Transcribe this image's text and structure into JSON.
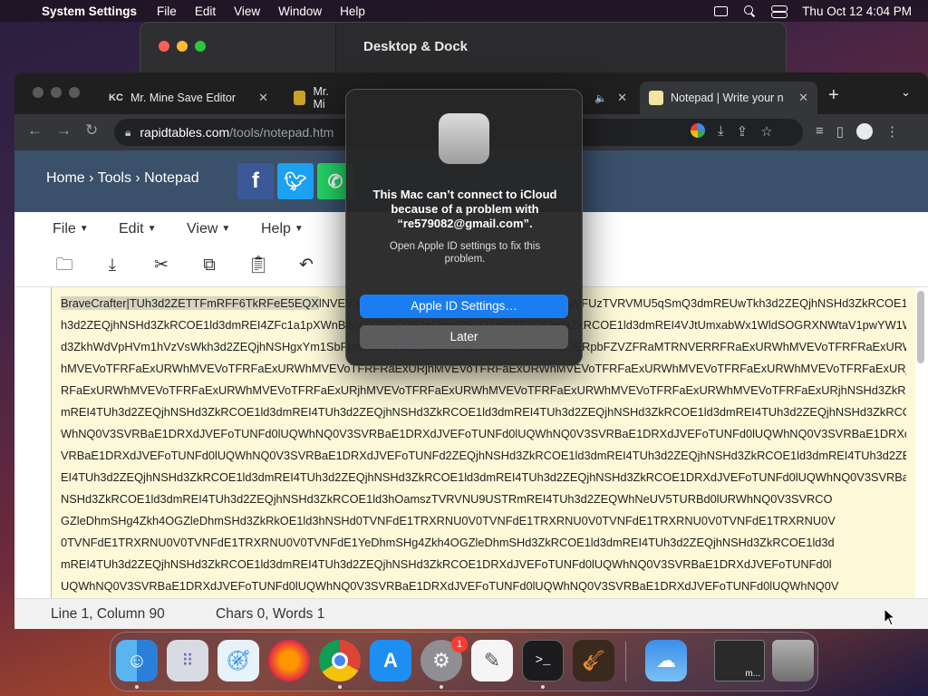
{
  "menubar": {
    "app_name": "System Settings",
    "items": [
      "File",
      "Edit",
      "View",
      "Window",
      "Help"
    ],
    "clock": "Thu Oct 12  4:04 PM"
  },
  "settings_window": {
    "title": "Desktop & Dock"
  },
  "browser": {
    "tabs": [
      {
        "label": "Mr. Mine Save Editor",
        "favicon": "KC"
      },
      {
        "label": "Mr. Mi",
        "favicon": ""
      },
      {
        "label": "Notepad | Write your n",
        "favicon": ""
      }
    ],
    "url_host": "rapidtables.com",
    "url_path": "/tools/notepad.htm"
  },
  "site": {
    "breadcrumb": "Home › Tools › Notepad",
    "menu": [
      "File",
      "Edit",
      "View",
      "Help"
    ]
  },
  "editor": {
    "lines": [
      "BraveCrafter|TUh3d2ZETTFmRFF6TkRFeE5EQXlNVEV3TkRZNU4yMDBNREF4TmpFM05UUTBNVFUzTVRVMU5qSmQ3dmREUwTkh3d2ZEQjhNSHd3ZkRCOE1ld3dmREI4TU",
      "h3d2ZEQjhNSHd3ZkRCOE1ld3dmREI4ZFc1a1pXWnBibVZrZkRCOE1ld3dmREI4TUh3ZEJOSHd3ZkRCOE1ld3dmREI4VJtUmxabWx1WldSOGRXNWtaV1pwYW1Wa2ZEQjhNSH",
      "d3ZkhWdVpHVm1hVzVsWkh3d2ZEQjhNSHgxYm1SbFptbHVaV1J8ZEJOSHd3ZkRCOE1ld3dmREIERpbFZVZFRaMTRNVERRFRaExURWhMVEVoTFRFRaExURWhMVEVoTFRFRaExURj",
      "hMVEVoTFRFaExURWhMVEVoTFRFaExURWhMVEVoTFRFRaExURjhMVEVoTFRFaExURWhMVEVoTFRFaExURWhMVEVoTFRFaExURWhMVEVoTFRFaExURjhMVEVoTFRFaExURWhMVEVoTF",
      "RFaExURWhMVEVoTFRFaExURWhMVEVoTFRFaExURjhMVEVoTFRFaExURWhMVEVoTFRFaExURWhMVEVoTFRFaExURWhMVEVoTFRFaExURjhNSHd3ZkRCOE1ld3dmREI4TUh3d2",
      "mREI4TUh3d2ZEQjhNSHd3ZkRCOE1ld3dmREI4TUh3d2ZEQjhNSHd3ZkRCOE1ld3dmREI4TUh3d2ZEQjhNSHd3ZkRCOE1ld3dmREI4TUh3d2ZEQjhNSHd3ZkRCOE1ld3dmREI4TUh3M2ZEQ",
      "WhNQ0V3SVRBaE1DRXdJVEFoTUNFd0lUQWhNQ0V3SVRBaE1DRXdJVEFoTUNFd0lUQWhNQ0V3SVRBaE1DRXdJVEFoTUNFd0lUQWhNQ0V3SVRBaE1DRXdJVEFoTUNFd0lUQWhNQ0V3S",
      "VRBaE1DRXdJVEFoTUNFd0lUQWhNQ0V3SVRBaE1DRXdJVEFoTUNFd2ZEQjhNSHd3ZkRCOE1ld3dmREI4TUh3d2ZEQjhNSHd3ZkRCOE1ld3dmREI4TUh3d2ZEQjhNSHd3ZkRCOE1ld3dmR",
      "EI4TUh3d2ZEQjhNSHd3ZkRCOE1ld3dmREI4TUh3d2ZEQjhNSHd3ZkRCOE1ld3dmREI4TUh3d2ZEQjhNSHd3ZkRCOE1DRXdJVEFoTUNFd0lUQWhNQ0V3SVRBaE1ld3dmREI4TUh3d2ZEQjh",
      "NSHd3ZkRCOE1ld3dmREI4TUh3d2ZEQjhNSHd3ZkRCOE1ld3hOamszTVRVNU9USTRmREI4TUh3d2ZEQWhNeUV5TURBd0lURWhNQ0V3SVRCO",
      "GZleDhmSHg4Zkh4OGZleDhmSHd3ZkRkOE1ld3hNSHd0TVNFdE1TRXRNU0V0TVNFdE1TRXRNU0V0TVNFdE1TRXRNU0V0TVNFdE1TRXRNU0V",
      "0TVNFdE1TRXRNU0V0TVNFdE1TRXRNU0V0TVNFdE1YeDhmSHg4Zkh4OGZleDhmSHd3ZkRCOE1ld3dmREI4TUh3d2ZEQjhNSHd3ZkRCOE1ld3d",
      "mREI4TUh3d2ZEQjhNSHd3ZkRCOE1ld3dmREI4TUh3d2ZEQjhNSHd3ZkRCOE1DRXdJVEFoTUNFd0lUQWhNQ0V3SVRBaE1DRXdJVEFoTUNFd0l",
      "UQWhNQ0V3SVRBaE1DRXdJVEFoTUNFd0lUQWhNQ0V3SVRBaE1DRXdJVEFoTUNFd0lUQWhNQ0V3SVRBaE1DRXdJVEFoTUNFd0lUQWhNQ0V"
    ],
    "highlight": "BraveCrafter|TUh3d2ZETTFmRFF6TkRFeE5EQX"
  },
  "statusbar": {
    "position": "Line 1, Column 90",
    "counts": "Chars 0, Words 1"
  },
  "alert": {
    "title": "This Mac can’t connect to iCloud because of a problem with “re579082@gmail.com”.",
    "message": "Open Apple ID settings to fix this problem.",
    "primary_button": "Apple ID Settings…",
    "secondary_button": "Later"
  },
  "dock": {
    "apps": [
      "Finder",
      "Launchpad",
      "Safari",
      "Firefox",
      "Chrome",
      "App Store",
      "System Settings",
      "TextEdit",
      "Terminal",
      "GarageBand",
      "Weather",
      "Window",
      "Trash"
    ],
    "settings_badge": "1",
    "window_label": "m..."
  }
}
